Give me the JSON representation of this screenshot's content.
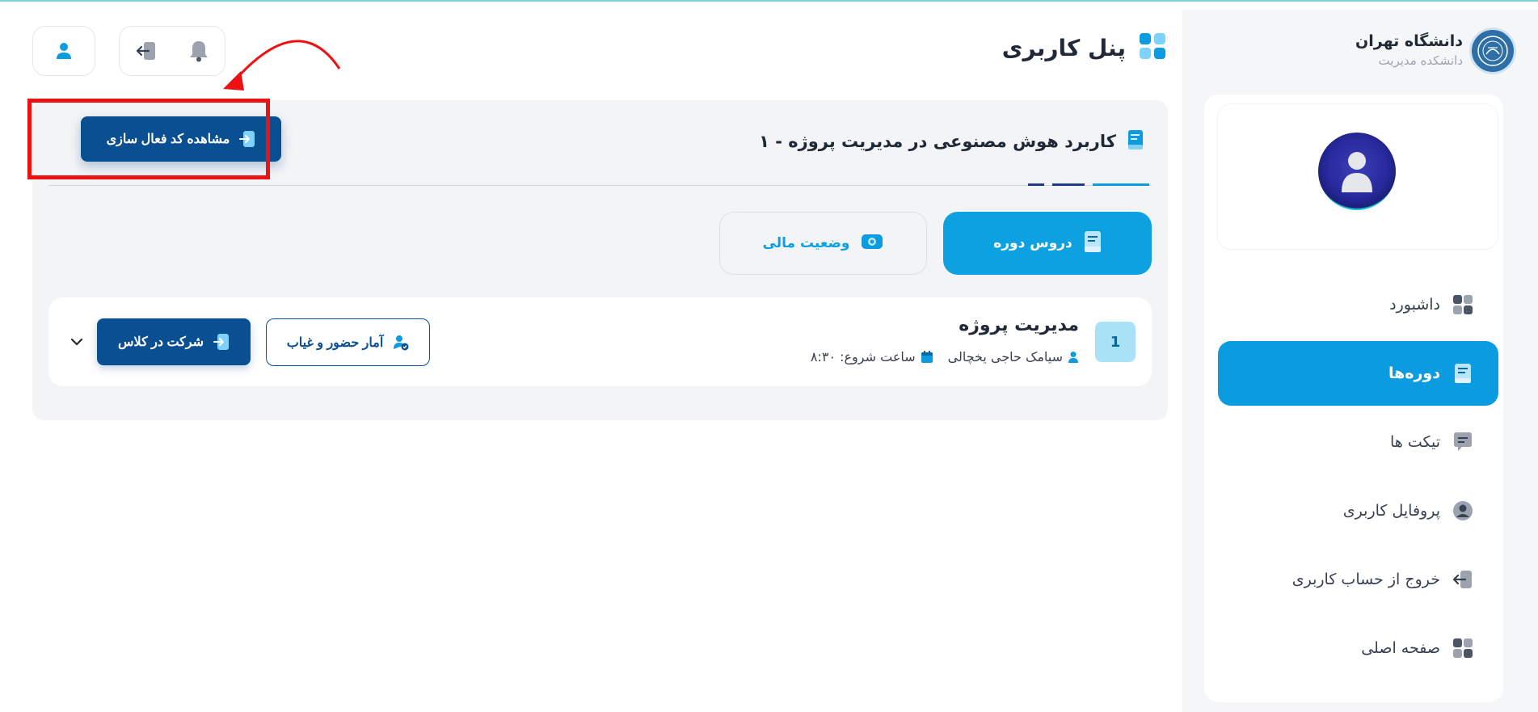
{
  "university": {
    "name": "دانشگاه تهران",
    "faculty": "دانشکده مدیریت",
    "logo_text": "دانشگاه"
  },
  "header": {
    "title": "پنل کاربری",
    "icons": [
      "grid-icon",
      "bell-icon",
      "logout-icon",
      "user-icon"
    ]
  },
  "sidebar": {
    "items": [
      {
        "label": "داشبورد",
        "icon": "dashboard-icon"
      },
      {
        "label": "دوره‌ها",
        "icon": "book-icon",
        "active": true
      },
      {
        "label": "تیکت ها",
        "icon": "chat-icon"
      },
      {
        "label": "پروفایل کاربری",
        "icon": "profile-icon"
      },
      {
        "label": "خروج از حساب کاربری",
        "icon": "logout-icon"
      },
      {
        "label": "صفحه اصلی",
        "icon": "home-grid-icon"
      }
    ]
  },
  "course": {
    "title": "کاربرد هوش مصنوعی در مدیریت پروژه - ۱",
    "activation_button": "مشاهده کد فعال سازی",
    "tabs": [
      {
        "label": "دروس دوره",
        "active": true
      },
      {
        "label": "وضعیت مالی",
        "active": false
      }
    ],
    "lessons": [
      {
        "number": "1",
        "name": "مدیریت پروژه",
        "teacher": "سیامک حاجی یخچالی",
        "start_time": "ساعت شروع: ۸:۳۰",
        "attendance_button": "آمار حضور و غیاب",
        "join_button": "شرکت در کلاس"
      }
    ]
  },
  "colors": {
    "primary": "#0b9be0",
    "dark_button": "#0b4f93",
    "highlight": "#ee1111",
    "panel_bg": "#f3f4f6"
  }
}
